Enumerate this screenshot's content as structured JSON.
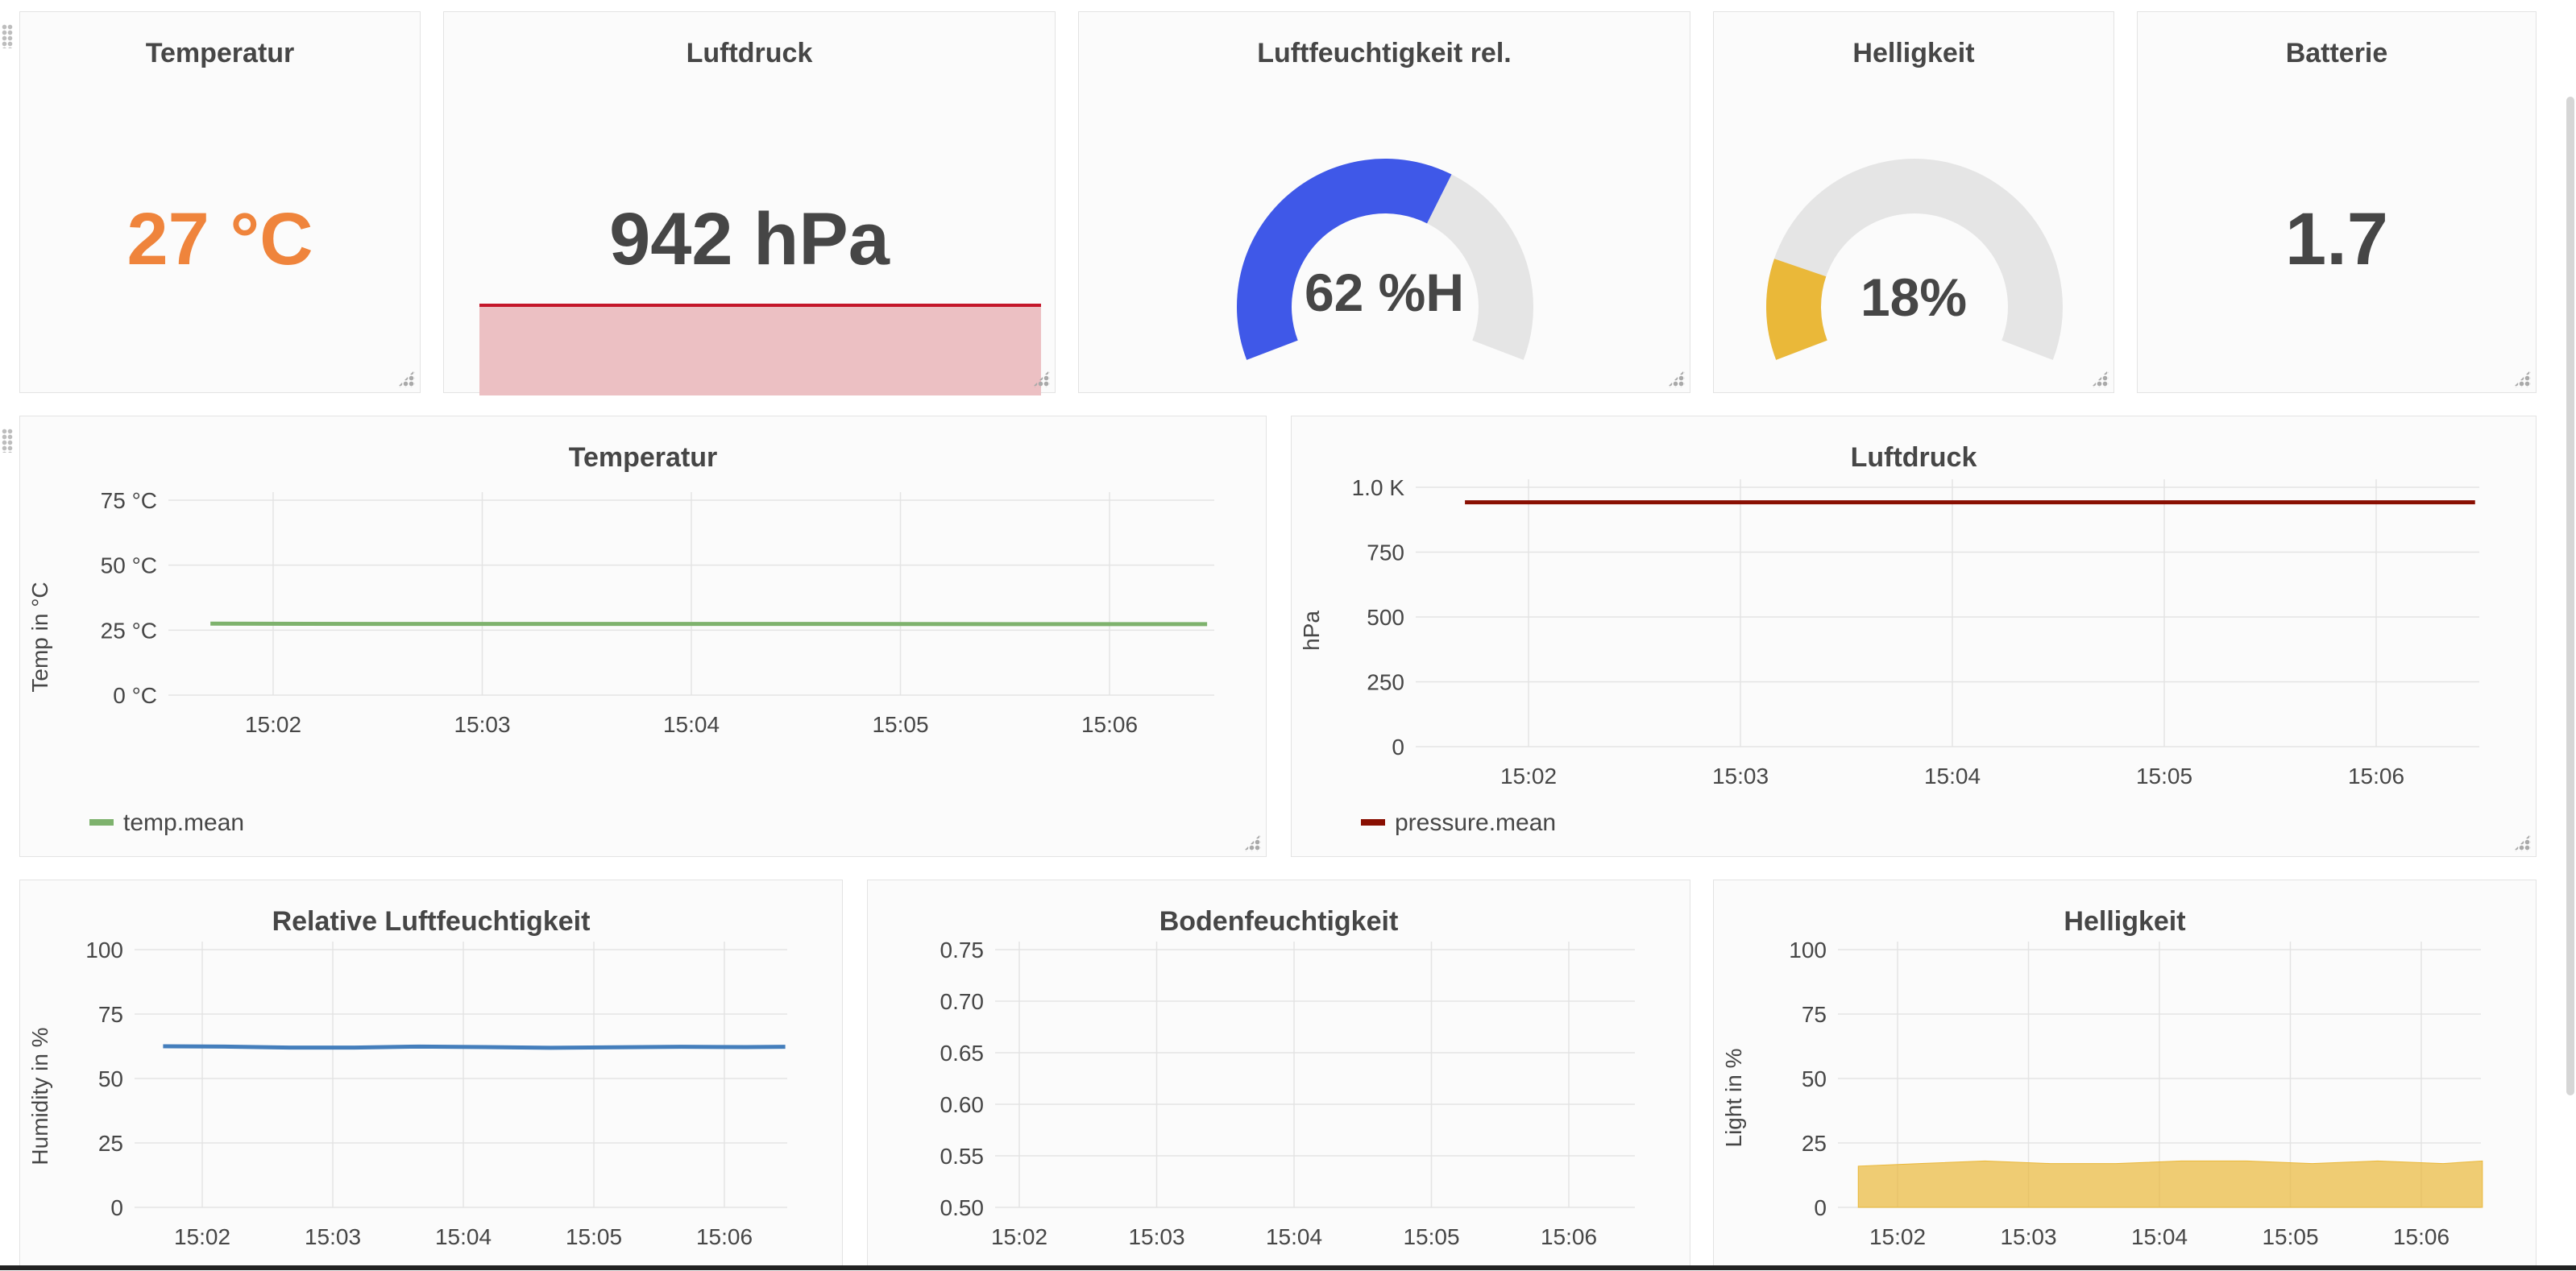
{
  "stats": {
    "temperature": {
      "title": "Temperatur",
      "value": "27 °C",
      "color": "#ef843c"
    },
    "pressure": {
      "title": "Luftdruck",
      "value": "942 hPa",
      "color": "#464646",
      "spark_color": "#c4162a"
    },
    "humidity": {
      "title": "Luftfeuchtigkeit rel.",
      "value": "62 %H",
      "fraction": 0.62,
      "color": "#3f58e8"
    },
    "brightness": {
      "title": "Helligkeit",
      "value": "18%",
      "fraction": 0.18,
      "color": "#eab839"
    },
    "battery": {
      "title": "Batterie",
      "value": "1.7",
      "color": "#464646"
    }
  },
  "charts": {
    "temp": {
      "title": "Temperatur",
      "ylabel": "Temp in °C",
      "legend": "temp.mean"
    },
    "pressure": {
      "title": "Luftdruck",
      "ylabel": "hPa",
      "legend": "pressure.mean"
    },
    "humidity": {
      "title": "Relative Luftfeuchtigkeit",
      "ylabel": "Humidity in %"
    },
    "soil": {
      "title": "Bodenfeuchtigkeit"
    },
    "light": {
      "title": "Helligkeit",
      "ylabel": "Light in %"
    }
  },
  "chart_data": [
    {
      "id": "temp",
      "type": "line",
      "title": "Temperatur",
      "ylabel": "Temp in °C",
      "xlabel": "",
      "x_ticks": [
        "15:02",
        "15:03",
        "15:04",
        "15:05",
        "15:06"
      ],
      "y_ticks": [
        "75 °C",
        "50 °C",
        "25 °C",
        "0 °C"
      ],
      "ylim": [
        0,
        75
      ],
      "grid": true,
      "legend_position": "bottom-left",
      "series": [
        {
          "name": "temp.mean",
          "color": "#7eb26d",
          "x": [
            "15:01:42",
            "15:02:30",
            "15:03:30",
            "15:04:30",
            "15:05:30",
            "15:06:28"
          ],
          "values": [
            27.5,
            27.4,
            27.4,
            27.4,
            27.3,
            27.3
          ]
        }
      ]
    },
    {
      "id": "pressure",
      "type": "line",
      "title": "Luftdruck",
      "ylabel": "hPa",
      "xlabel": "",
      "x_ticks": [
        "15:02",
        "15:03",
        "15:04",
        "15:05",
        "15:06"
      ],
      "y_ticks": [
        "1.0 K",
        "750",
        "500",
        "250",
        "0"
      ],
      "ylim": [
        0,
        1000
      ],
      "grid": true,
      "legend_position": "bottom-left",
      "series": [
        {
          "name": "pressure.mean",
          "color": "#890f02",
          "x": [
            "15:01:42",
            "15:06:28"
          ],
          "values": [
            942,
            942
          ]
        }
      ]
    },
    {
      "id": "humidity",
      "type": "line",
      "title": "Relative Luftfeuchtigkeit",
      "ylabel": "Humidity in %",
      "xlabel": "",
      "x_ticks": [
        "15:02",
        "15:03",
        "15:04",
        "15:05",
        "15:06"
      ],
      "y_ticks": [
        "100",
        "75",
        "50",
        "25",
        "0"
      ],
      "ylim": [
        0,
        100
      ],
      "grid": true,
      "legend_position": "none",
      "series": [
        {
          "name": "",
          "color": "#447ebc",
          "x": [
            "15:01:42",
            "15:02:10",
            "15:02:40",
            "15:03:10",
            "15:03:40",
            "15:04:10",
            "15:04:40",
            "15:05:10",
            "15:05:40",
            "15:06:10",
            "15:06:28"
          ],
          "values": [
            62.5,
            62.4,
            62.0,
            62.0,
            62.4,
            62.2,
            61.9,
            62.1,
            62.3,
            62.2,
            62.3
          ]
        }
      ]
    },
    {
      "id": "soil",
      "type": "line",
      "title": "Bodenfeuchtigkeit",
      "ylabel": "",
      "xlabel": "",
      "x_ticks": [
        "15:02",
        "15:03",
        "15:04",
        "15:05",
        "15:06"
      ],
      "y_ticks": [
        "0.75",
        "0.70",
        "0.65",
        "0.60",
        "0.55",
        "0.50"
      ],
      "ylim": [
        0.5,
        0.75
      ],
      "grid": true,
      "legend_position": "none",
      "series": []
    },
    {
      "id": "light",
      "type": "area",
      "title": "Helligkeit",
      "ylabel": "Light in %",
      "xlabel": "",
      "x_ticks": [
        "15:02",
        "15:03",
        "15:04",
        "15:05",
        "15:06"
      ],
      "y_ticks": [
        "100",
        "75",
        "50",
        "25",
        "0"
      ],
      "ylim": [
        0,
        100
      ],
      "grid": true,
      "legend_position": "none",
      "series": [
        {
          "name": "",
          "color": "#eab839",
          "x": [
            "15:01:42",
            "15:02:10",
            "15:02:40",
            "15:03:10",
            "15:03:40",
            "15:04:10",
            "15:04:40",
            "15:05:10",
            "15:05:40",
            "15:06:10",
            "15:06:28"
          ],
          "values": [
            16,
            17,
            18,
            17,
            17,
            18,
            18,
            17,
            18,
            17,
            18
          ]
        }
      ]
    }
  ]
}
